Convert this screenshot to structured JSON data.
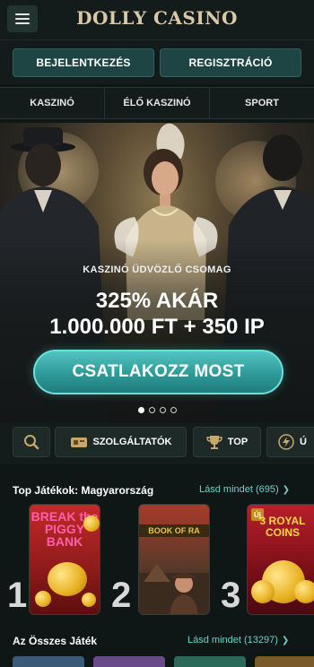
{
  "header": {
    "logo": "DOLLY CASINO",
    "menu_icon": "hamburger-icon"
  },
  "auth": {
    "login_label": "BEJELENTKEZÉS",
    "register_label": "REGISZTRÁCIÓ"
  },
  "nav": {
    "tabs": [
      {
        "label": "KASZINÓ"
      },
      {
        "label": "ÉLŐ KASZINÓ"
      },
      {
        "label": "SPORT"
      }
    ]
  },
  "hero": {
    "promo_label": "KASZINÓ ÜDVÖZLŐ CSOMAG",
    "line1": "325% AKÁR",
    "line2": "1.000.000 FT + 350 IP",
    "cta_label": "CSATLAKOZZ MOST",
    "slides_count": 4,
    "active_slide": 1
  },
  "categories": {
    "search_icon": "search-icon",
    "services_label": "SZOLGÁLTATÓK",
    "top_label": "TOP",
    "extra_label": "Ú"
  },
  "top_games": {
    "title": "Top Játékok: Magyarország",
    "see_all": "Lásd mindet (695)",
    "ranks": [
      "1",
      "2",
      "3"
    ],
    "games": [
      {
        "caption": "BREAK the PIGGY BANK"
      },
      {
        "caption": "BOOK OF RA"
      },
      {
        "caption": "3 ROYAL COINS"
      }
    ]
  },
  "all_games": {
    "title": "Az Összes Játék",
    "see_all": "Lásd mindet (13297)"
  },
  "colors": {
    "accent": "#6fd0c8",
    "cta": "#2e9a98",
    "gold": "#d8c8a8"
  }
}
